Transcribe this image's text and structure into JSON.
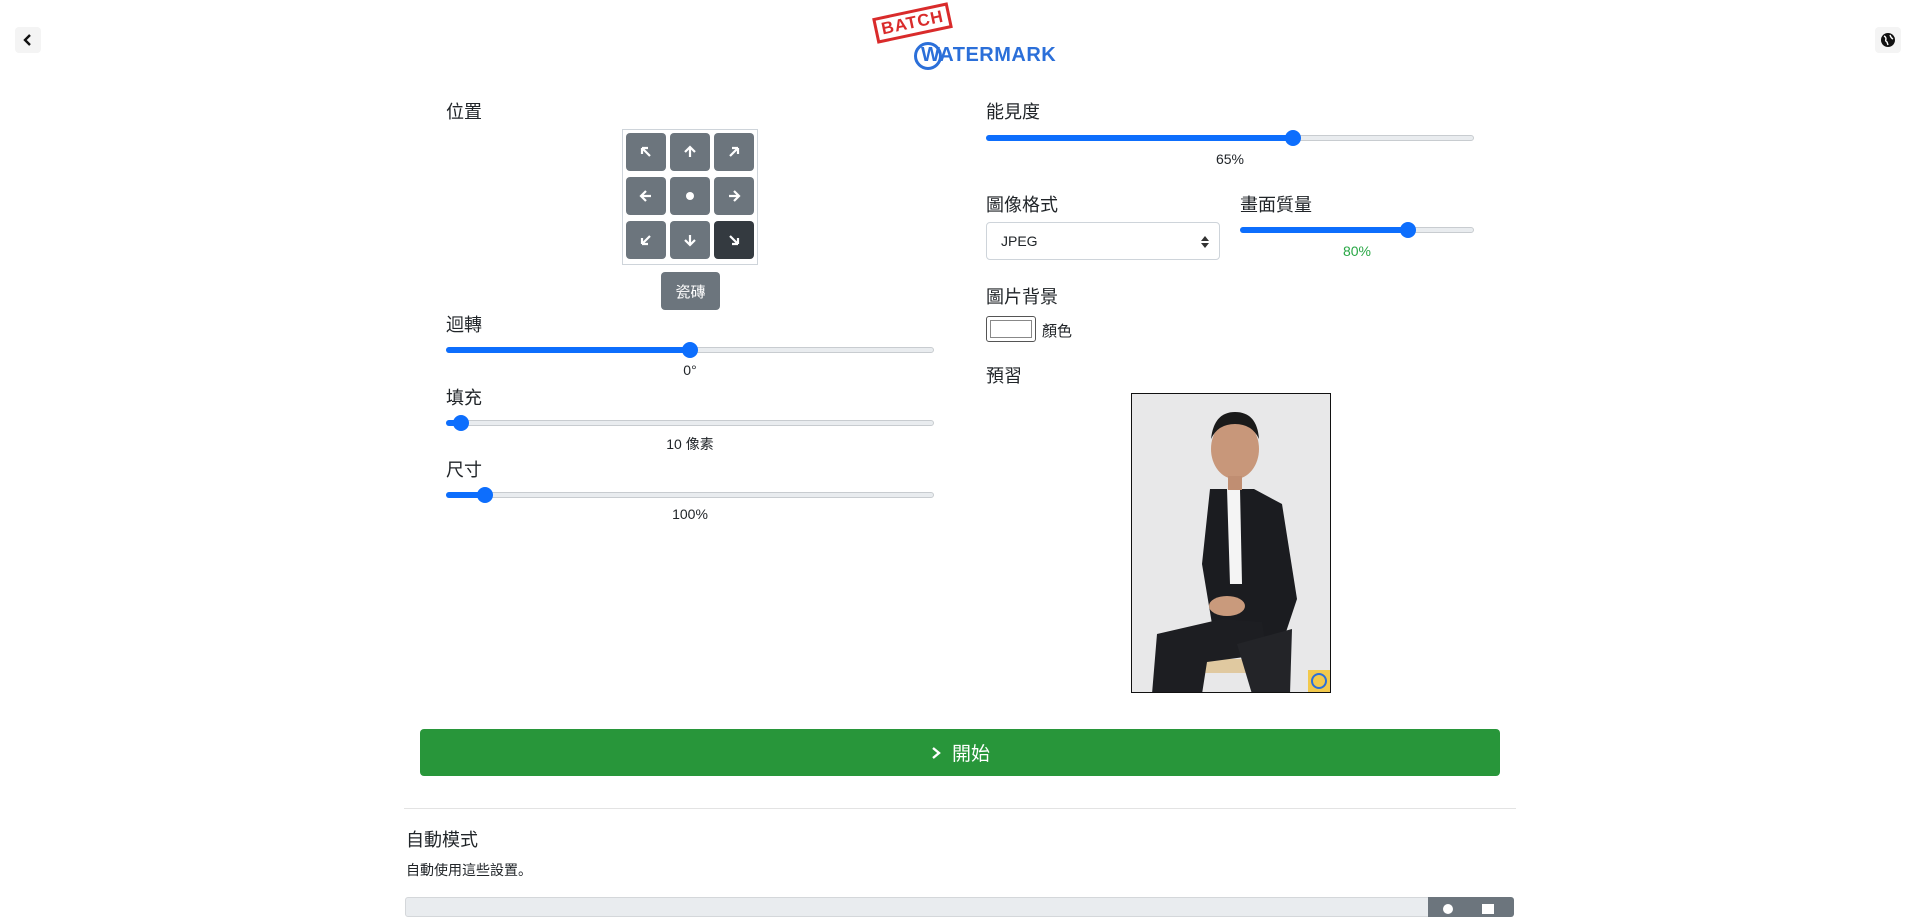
{
  "logo": {
    "top_text": "BATCH",
    "bottom_text": "WATERMARK",
    "colors": {
      "stamp": "#d92b2b",
      "brand": "#2b6fd9"
    }
  },
  "header": {
    "back_icon": "chevron-left-icon",
    "language_icon": "globe-icon"
  },
  "position": {
    "label": "位置",
    "selected": "bottom-right",
    "tile_button": "瓷磚"
  },
  "rotation": {
    "label": "迴轉",
    "value_text": "0°",
    "value_fraction": 0.5
  },
  "padding": {
    "label": "填充",
    "value_text": "10 像素",
    "value_fraction": 0.03
  },
  "size": {
    "label": "尺寸",
    "value_text": "100%",
    "value_fraction": 0.08
  },
  "visibility": {
    "label": "能見度",
    "value_text": "65%",
    "value_fraction": 0.63
  },
  "image_format": {
    "label": "圖像格式",
    "selected": "JPEG"
  },
  "quality": {
    "label": "畫面質量",
    "value_text": "80%",
    "value_fraction": 0.72,
    "value_color": "#28a745"
  },
  "background": {
    "label": "圖片背景",
    "color_label": "顏色"
  },
  "preview": {
    "label": "預習"
  },
  "start_button": {
    "label": "開始",
    "color": "#28963a"
  },
  "auto_mode": {
    "title": "自動模式",
    "description": "自動使用這些設置。"
  },
  "colors": {
    "accent": "#0d6efd",
    "button_gray": "#6c757d",
    "button_dark": "#343a40"
  }
}
